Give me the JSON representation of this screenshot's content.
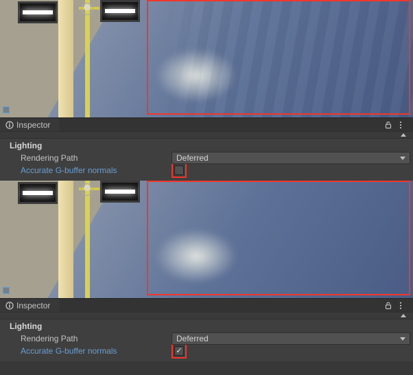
{
  "panels": [
    {
      "inspector_tab": "Inspector",
      "section": "Lighting",
      "rendering_path_label": "Rendering Path",
      "rendering_path_value": "Deferred",
      "accurate_normals_label": "Accurate G-buffer normals",
      "accurate_normals_checked": false
    },
    {
      "inspector_tab": "Inspector",
      "section": "Lighting",
      "rendering_path_label": "Rendering Path",
      "rendering_path_value": "Deferred",
      "accurate_normals_label": "Accurate G-buffer normals",
      "accurate_normals_checked": true
    }
  ],
  "icons": {
    "info": "info-icon",
    "lock": "lock-icon",
    "more": "more-icon"
  },
  "colors": {
    "highlight": "#f3362a",
    "link": "#6a9fd4",
    "panel_bg": "#3f3f3f"
  }
}
